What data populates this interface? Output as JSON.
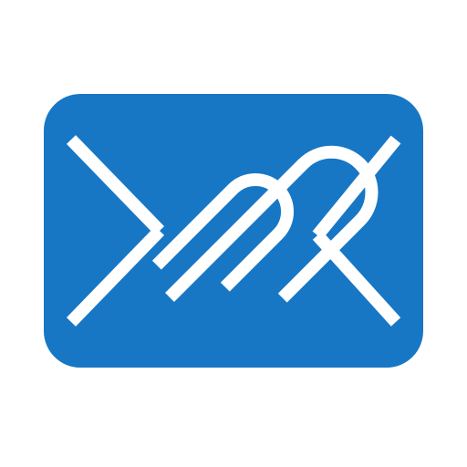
{
  "icon": {
    "name": "mail-attachment-icon",
    "envelope_color": "#1777C5",
    "line_color": "#FFFFFF",
    "background_color": "#FFFFFF"
  }
}
